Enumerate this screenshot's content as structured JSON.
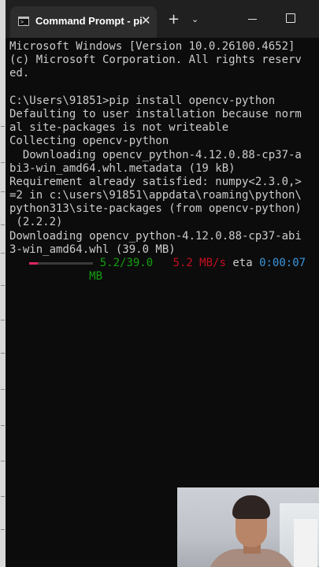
{
  "titlebar": {
    "tab_title": "Command Prompt - pi",
    "tab_icon": "cmd-icon",
    "close_glyph": "✕",
    "new_tab_glyph": "+",
    "dropdown_glyph": "⌄"
  },
  "terminal": {
    "colors": {
      "text": "#cccccc",
      "green": "#13a10e",
      "red": "#c50f1f",
      "cyan": "#3a96dd",
      "progress_bar": "#e0245e"
    },
    "lines": [
      "Microsoft Windows [Version 10.0.26100.4652]",
      "(c) Microsoft Corporation. All rights reserv",
      "ed.",
      "",
      "C:\\Users\\91851>pip install opencv-python",
      "Defaulting to user installation because norm",
      "al site-packages is not writeable",
      "Collecting opencv-python",
      "  Downloading opencv_python-4.12.0.88-cp37-a",
      "bi3-win_amd64.whl.metadata (19 kB)",
      "Requirement already satisfied: numpy<2.3.0,>",
      "=2 in c:\\users\\91851\\appdata\\roaming\\python\\",
      "python313\\site-packages (from opencv-python)",
      " (2.2.2)",
      "Downloading opencv_python-4.12.0.88-cp37-abi",
      "3-win_amd64.whl (39.0 MB)"
    ],
    "progress": {
      "fraction": 0.133,
      "size": "5.2/39.0",
      "size_unit": "MB",
      "speed": "5.2 MB/s",
      "eta_label": "eta",
      "eta": "0:00:07"
    }
  }
}
